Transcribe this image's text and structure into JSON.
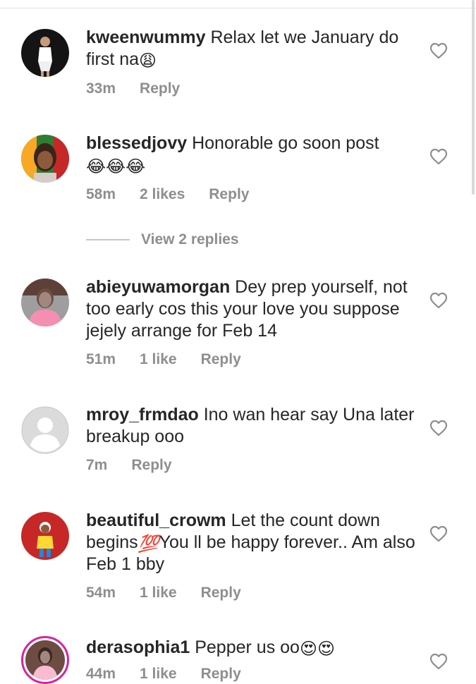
{
  "comments": [
    {
      "username": "kweenwummy",
      "text_before": " Relax let we January do first na",
      "emoji": "😩",
      "text_after": "",
      "time": "33m",
      "likes": "",
      "reply": "Reply",
      "avatar_icon": "user-photo-icon",
      "colors": {
        "bg": "#141414",
        "figure": "#ffffff"
      }
    },
    {
      "username": "blessedjovy",
      "text_before": " Honorable go soon post",
      "emoji": "😂😂😂",
      "text_after": "",
      "time": "58m",
      "likes": "2 likes",
      "reply": "Reply",
      "avatar_icon": "user-photo-icon",
      "colors": {
        "bg": "#2e7d32",
        "figure": "#3a2418"
      }
    },
    {
      "username": "abieyuwamorgan",
      "text_before": " Dey prep yourself, not too early cos this your love you suppose jejely arrange for Feb 14",
      "emoji": "",
      "text_after": "",
      "time": "51m",
      "likes": "1 like",
      "reply": "Reply",
      "avatar_icon": "user-photo-icon",
      "colors": {
        "bg": "#9e9e9e",
        "figure": "#f48fb1"
      }
    },
    {
      "username": "mroy_frmdao",
      "text_before": " Ino wan hear say Una later breakup ooo",
      "emoji": "",
      "text_after": "",
      "time": "7m",
      "likes": "",
      "reply": "Reply",
      "avatar_icon": "default-avatar-icon",
      "colors": {
        "bg": "#dbdbdb",
        "figure": "#ffffff"
      }
    },
    {
      "username": "beautiful_crowm",
      "text_before": " Let the count down begins",
      "emoji": "💯",
      "text_after": "You ll be happy forever.. Am also Feb 1 bby",
      "time": "54m",
      "likes": "1 like",
      "reply": "Reply",
      "avatar_icon": "user-photo-icon",
      "colors": {
        "bg": "#c62828",
        "figure": "#fdd835"
      }
    },
    {
      "username": "derasophia1",
      "text_before": " Pepper us oo",
      "emoji": "😍😍",
      "text_after": "",
      "time": "44m",
      "likes": "1 like",
      "reply": "Reply",
      "avatar_icon": "story-ring-avatar-icon",
      "colors": {
        "bg": "#6d4c41",
        "figure": "#f8bbd0"
      }
    }
  ],
  "view_replies": "View 2 replies",
  "icons": {
    "like": "heart-outline-icon"
  },
  "colors": {
    "text": "#262626",
    "meta": "#8e8e8e",
    "story_ring": "#d6249f"
  }
}
